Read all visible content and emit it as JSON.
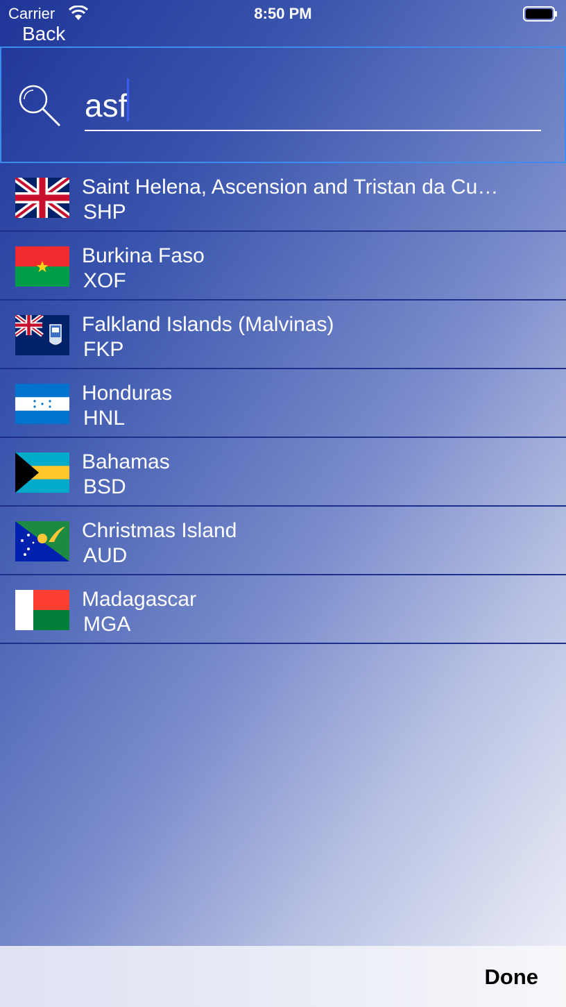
{
  "status_bar": {
    "carrier": "Carrier",
    "time": "8:50 PM"
  },
  "nav": {
    "back_label": "Back"
  },
  "search": {
    "value": "asf",
    "icon": "search-icon"
  },
  "countries": [
    {
      "name": "Saint Helena, Ascension and Tristan da Cu…",
      "code": "SHP",
      "flag": "saint-helena-flag"
    },
    {
      "name": "Burkina Faso",
      "code": "XOF",
      "flag": "burkina-faso-flag"
    },
    {
      "name": "Falkland Islands (Malvinas)",
      "code": "FKP",
      "flag": "falkland-islands-flag"
    },
    {
      "name": "Honduras",
      "code": "HNL",
      "flag": "honduras-flag"
    },
    {
      "name": "Bahamas",
      "code": "BSD",
      "flag": "bahamas-flag"
    },
    {
      "name": "Christmas Island",
      "code": "AUD",
      "flag": "christmas-island-flag"
    },
    {
      "name": "Madagascar",
      "code": "MGA",
      "flag": "madagascar-flag"
    }
  ],
  "toolbar": {
    "done_label": "Done"
  },
  "colors": {
    "accent_border": "#3d8cf0",
    "row_divider": "#1d2f8a",
    "caret": "#3c5cf5"
  }
}
